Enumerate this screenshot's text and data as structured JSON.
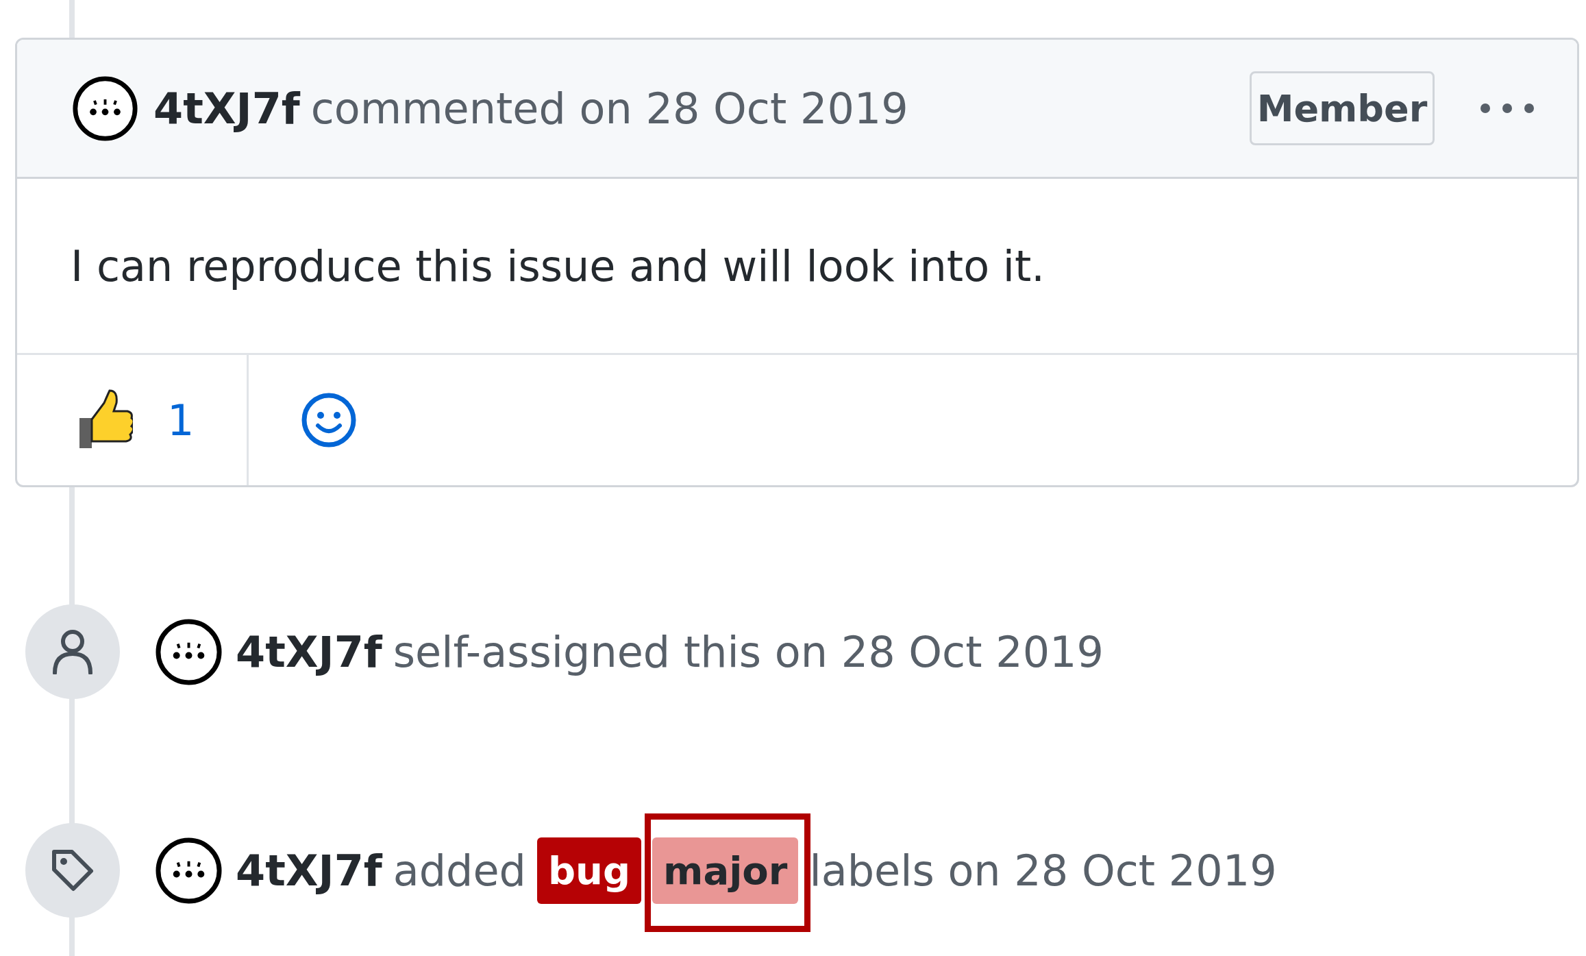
{
  "comment": {
    "author": "4tXJ7f",
    "action": "commented on 28 Oct 2019",
    "badge": "Member",
    "body": "I can reproduce this issue and will look into it.",
    "reactions": [
      {
        "kind": "thumbs_up",
        "count": "1"
      }
    ]
  },
  "events": [
    {
      "kind": "assigned",
      "actor": "4tXJ7f",
      "text": "self-assigned this on 28 Oct 2019"
    },
    {
      "kind": "labeled",
      "actor": "4tXJ7f",
      "text_before": "added",
      "labels": [
        {
          "name": "bug",
          "color": "#b60205",
          "highlighted": false
        },
        {
          "name": "major",
          "color": "#e99695",
          "highlighted": true
        }
      ],
      "text_after": "labels on 28 Oct 2019"
    }
  ]
}
